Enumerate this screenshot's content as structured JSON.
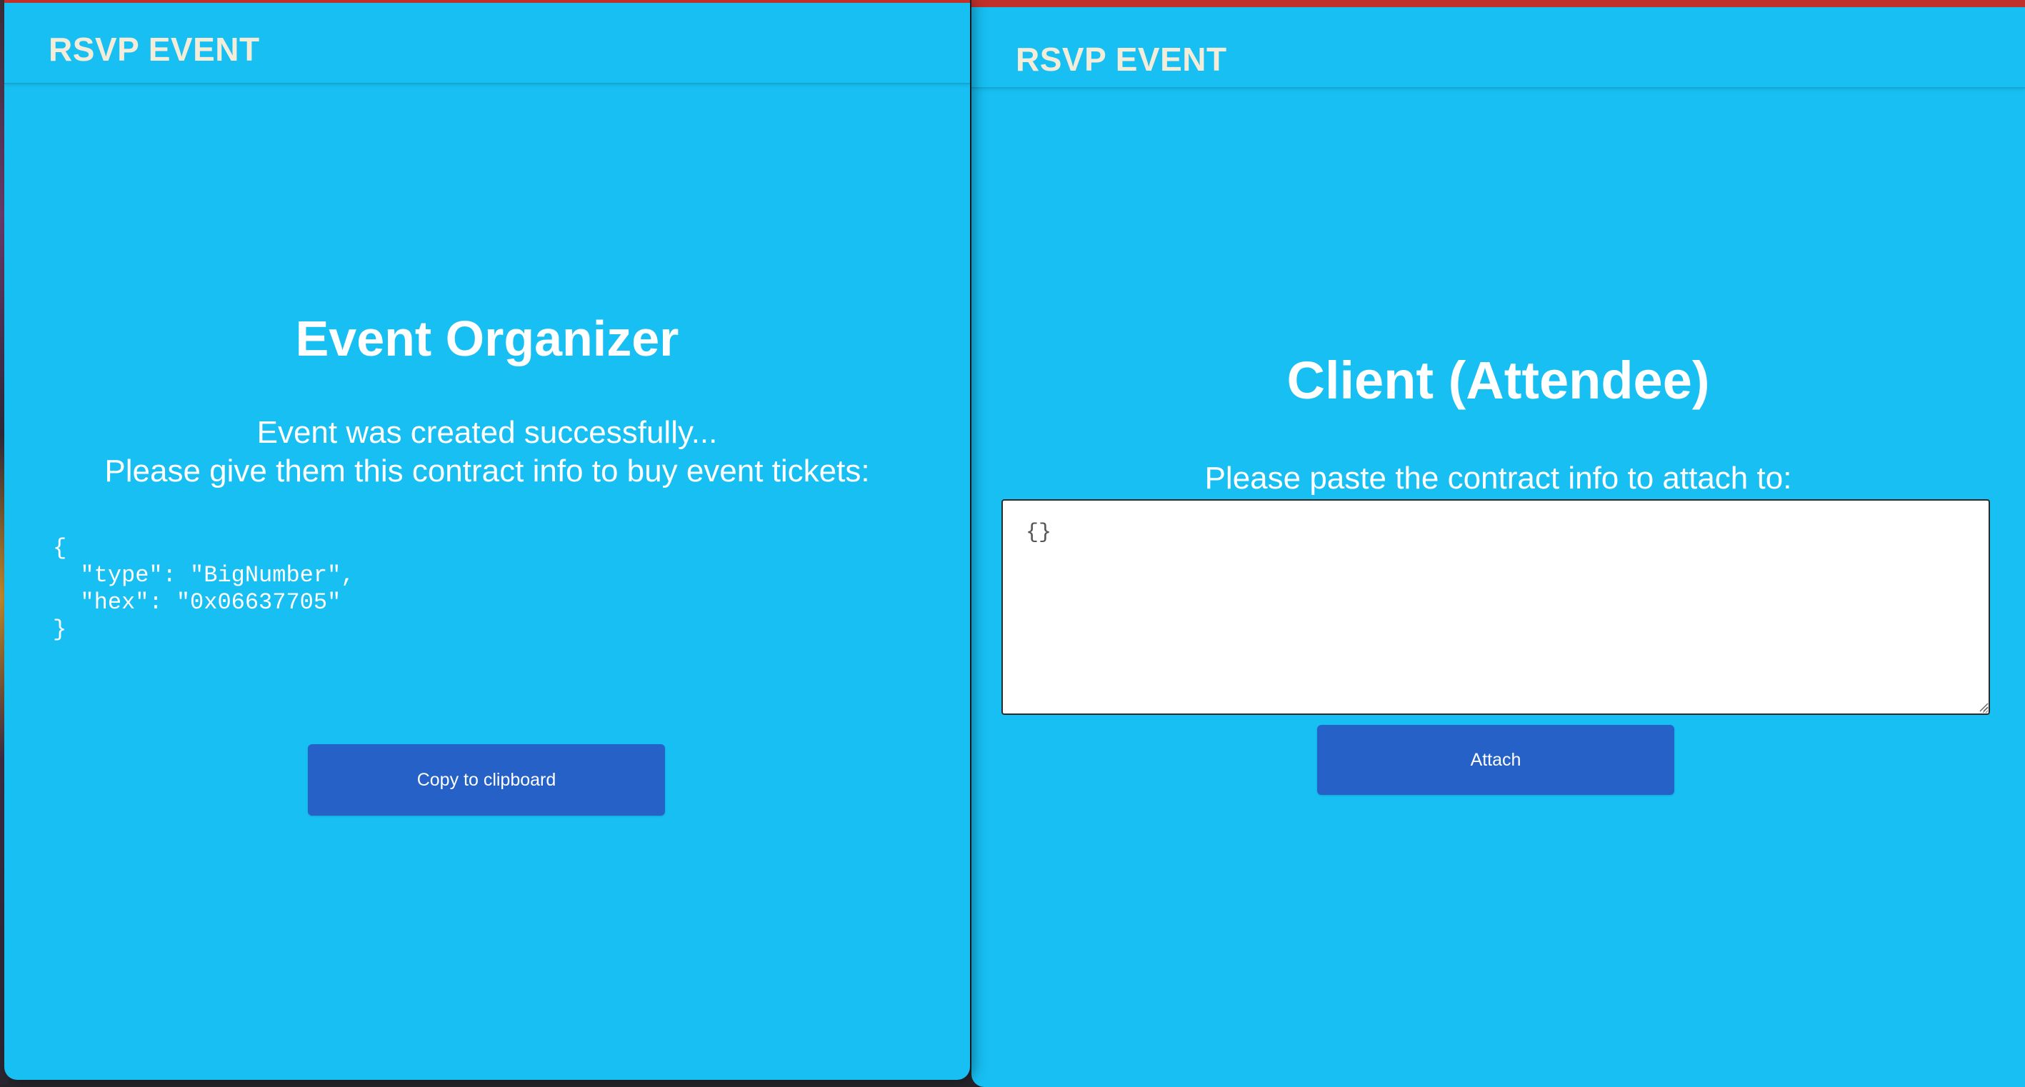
{
  "left_window": {
    "app_title": "RSVP EVENT",
    "heading": "Event Organizer",
    "message_line1": "Event was created successfully...",
    "message_line2": "Please give them this contract info to buy event tickets:",
    "contract_info": "{\n  \"type\": \"BigNumber\",\n  \"hex\": \"0x06637705\"\n}",
    "copy_button_label": "Copy to clipboard"
  },
  "right_window": {
    "app_title": "RSVP EVENT",
    "heading": "Client (Attendee)",
    "prompt": "Please paste the contract info to attach to:",
    "textarea_value": "{}",
    "attach_button_label": "Attach"
  },
  "colors": {
    "background": "#17bff3",
    "button": "#2561c7",
    "title_bar_accent": "#c2302c"
  }
}
